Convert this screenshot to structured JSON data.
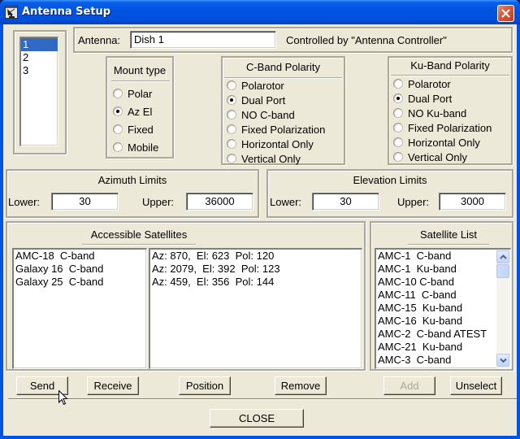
{
  "window": {
    "title": "Antenna Setup",
    "icon": "satellite-dish-icon",
    "close_icon": "close-icon"
  },
  "antenna_list": {
    "items": [
      "1",
      "2",
      "3"
    ],
    "selected_index": 0
  },
  "antenna": {
    "label": "Antenna:",
    "value": "Dish 1",
    "controlled_by": "Controlled by \"Antenna Controller\""
  },
  "mount_type": {
    "title": "Mount type",
    "options": [
      "Polar",
      "Az El",
      "Fixed",
      "Mobile"
    ],
    "selected": "Az El"
  },
  "c_band_polarity": {
    "title": "C-Band Polarity",
    "options": [
      "Polarotor",
      "Dual Port",
      "NO C-band",
      "Fixed Polarization",
      "Horizontal Only",
      "Vertical Only"
    ],
    "selected": "Dual Port"
  },
  "ku_band_polarity": {
    "title": "Ku-Band Polarity",
    "options": [
      "Polarotor",
      "Dual Port",
      "NO Ku-band",
      "Fixed Polarization",
      "Horizontal Only",
      "Vertical Only"
    ],
    "selected": "Dual Port"
  },
  "azimuth_limits": {
    "title": "Azimuth Limits",
    "lower_label": "Lower:",
    "lower_value": "30",
    "upper_label": "Upper:",
    "upper_value": "36000"
  },
  "elevation_limits": {
    "title": "Elevation Limits",
    "lower_label": "Lower:",
    "lower_value": "30",
    "upper_label": "Upper:",
    "upper_value": "3000"
  },
  "accessible_satellites": {
    "title": "Accessible Satellites",
    "names": [
      "AMC-18  C-band",
      "Galaxy 16  C-band",
      "Galaxy 25  C-band"
    ],
    "positions": [
      "Az: 870,  El: 623  Pol: 120",
      "Az: 2079,  El: 392  Pol: 123",
      "Az: 459,  El: 356  Pol: 144"
    ]
  },
  "satellite_list": {
    "title": "Satellite List",
    "items": [
      "AMC-1  C-band",
      "AMC-1  Ku-band",
      "AMC-10 C-band",
      "AMC-11  C-band",
      "AMC-15  Ku-band",
      "AMC-16  Ku-band",
      "AMC-2  C-band ATEST",
      "AMC-21  Ku-band",
      "AMC-3  C-band"
    ],
    "scroll_up_icon": "chevron-up-icon",
    "scroll_down_icon": "chevron-down-icon"
  },
  "buttons": {
    "send": "Send",
    "receive": "Receive",
    "position": "Position",
    "remove": "Remove",
    "add": "Add",
    "unselect": "Unselect",
    "close": "CLOSE"
  },
  "colors": {
    "titlebar": "#0054e3",
    "face": "#ece9d8",
    "selection": "#316ac5",
    "close_button": "#d9573a"
  }
}
